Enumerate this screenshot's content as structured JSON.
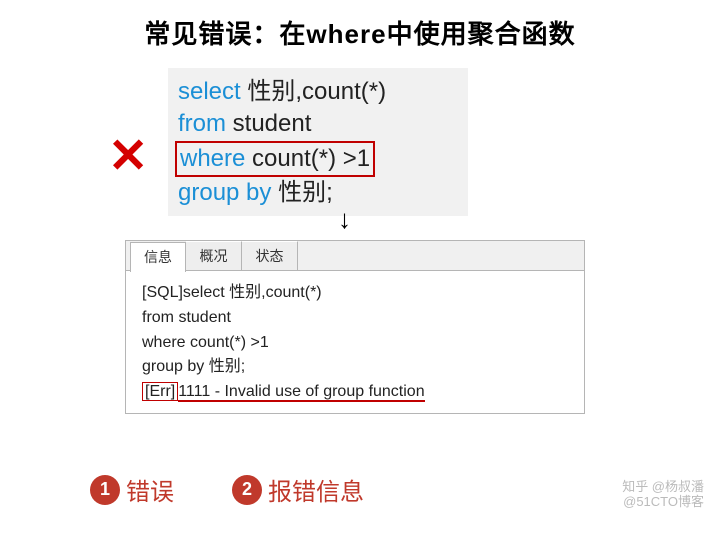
{
  "title": "常见错误：在where中使用聚合函数",
  "sql": {
    "l1_kw": "select",
    "l1_txt": " 性别,count(*)",
    "l2_kw": "from",
    "l2_txt": " student",
    "l3_kw": "where",
    "l3_txt": " count(*) >1",
    "l4_kw": "group by",
    "l4_txt": " 性别;"
  },
  "tabs": {
    "t1": "信息",
    "t2": "概况",
    "t3": "状态"
  },
  "result": {
    "l1": "[SQL]select 性别,count(*)",
    "l2": "from student",
    "l3": "where count(*) >1",
    "l4": "group by 性别;",
    "err_tag": "[Err]",
    "err_msg": "1111 - Invalid use of group function"
  },
  "legend": {
    "n1": "1",
    "t1": "错误",
    "n2": "2",
    "t2": "报错信息"
  },
  "watermark": {
    "l1": "知乎 @杨叔潘",
    "l2": "@51CTO博客"
  }
}
